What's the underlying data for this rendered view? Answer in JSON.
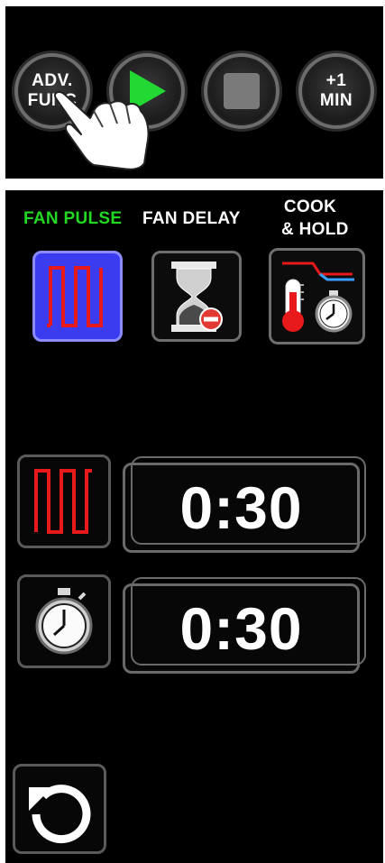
{
  "controls": {
    "adv_func_label_line1": "ADV.",
    "adv_func_label_line2": "FUNC",
    "plus_one_label_line1": "+1",
    "plus_one_label_line2": "MIN"
  },
  "modes": {
    "fan_pulse_label": "FAN PULSE",
    "fan_delay_label": "FAN DELAY",
    "cook_hold_label_line1": "COOK",
    "cook_hold_label_line2": "& HOLD",
    "active": "fan_pulse"
  },
  "settings": {
    "pulse_time": "0:30",
    "timer_time": "0:30"
  },
  "colors": {
    "active_label": "#22d822",
    "label": "#ffffff",
    "active_tile": "#3b3cf0",
    "pulse_wave": "#e8191b",
    "play_green": "#22d833"
  },
  "icons": {
    "adv_func": "adv-func",
    "play": "play-icon",
    "stop": "stop-icon",
    "plus_minute": "plus-minute",
    "pulse": "pulse-wave-icon",
    "hourglass": "hourglass-icon",
    "cook_hold": "thermometer-stopwatch-icon",
    "stopwatch": "stopwatch-icon",
    "reset": "reset-icon"
  }
}
